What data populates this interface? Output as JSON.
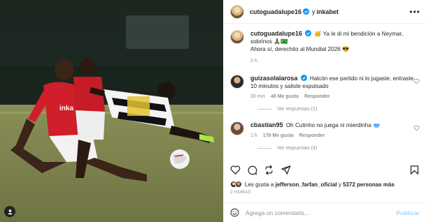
{
  "post": {
    "author": "cutoguadalupe16",
    "collab_separator": "y",
    "collaborator": "inkabet",
    "more_icon": "•••"
  },
  "caption": {
    "username": "cutoguadalupe16",
    "text": "🥳 Ya le di mi bendición a Neymar, sobrinos 🙏🏾🇧🇷",
    "text2": "Ahora sí, derechito al Mundial 2026 😎",
    "time": "2 h"
  },
  "comments": [
    {
      "username": "guizasolalarosa",
      "text": "Halcón ese partido ni lo jugaste, entraste 10 minutos y saliste expulsado",
      "time": "30 min",
      "likes": "48 Me gusta",
      "reply": "Responder",
      "view_replies": "Ver respuestas (1)"
    },
    {
      "username": "cbastian95",
      "text": "Oh Cutinho no juega ni mierdinha 🥣",
      "time": "1 h",
      "likes": "178 Me gusta",
      "reply": "Responder",
      "view_replies": "Ver respuestas (4)"
    }
  ],
  "likes": {
    "prefix": "Les gusta a",
    "user": "jefferson_farfan_oficial",
    "middle": "y",
    "count": "5372 personas más"
  },
  "time_ago": "2 HORAS",
  "add_comment": {
    "placeholder": "Agrega un comentario...",
    "post_label": "Publicar"
  },
  "colors": {
    "verified": "#0095f6",
    "link_disabled": "#a9d2f7",
    "muted": "#8e8e8e"
  }
}
